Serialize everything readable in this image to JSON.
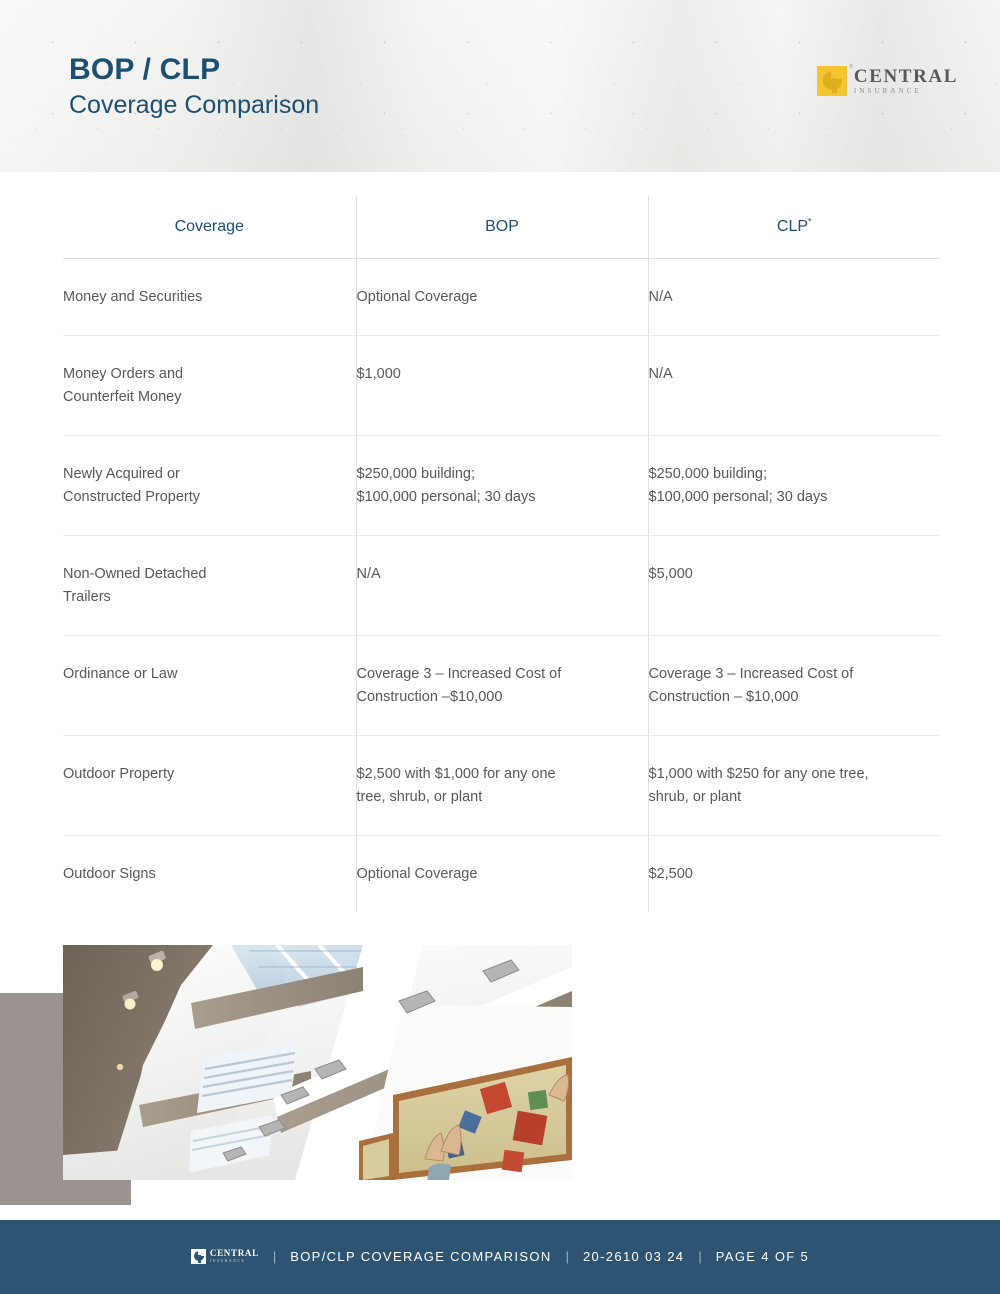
{
  "header": {
    "title_main": "BOP / CLP",
    "title_sub": "Coverage Comparison",
    "logo": {
      "name": "CENTRAL",
      "tagline": "INSURANCE",
      "registered_mark": "®"
    }
  },
  "table": {
    "columns": [
      {
        "label": "Coverage",
        "superscript": ""
      },
      {
        "label": "BOP",
        "superscript": ""
      },
      {
        "label": "CLP",
        "superscript": "*"
      }
    ],
    "rows": [
      {
        "coverage": "Money and Securities",
        "bop": "Optional Coverage",
        "clp": "N/A"
      },
      {
        "coverage": "Money Orders and\nCounterfeit Money",
        "bop": "$1,000",
        "clp": "N/A"
      },
      {
        "coverage": "Newly Acquired or\nConstructed Property",
        "bop": "$250,000 building;\n$100,000 personal; 30 days",
        "clp": "$250,000 building;\n$100,000 personal; 30 days"
      },
      {
        "coverage": "Non-Owned Detached\nTrailers",
        "bop": "N/A",
        "clp": "$5,000"
      },
      {
        "coverage": "Ordinance or Law",
        "bop": "Coverage 3 – Increased Cost of\nConstruction –$10,000",
        "clp": "Coverage 3 – Increased Cost of\nConstruction – $10,000"
      },
      {
        "coverage": "Outdoor Property",
        "bop": "$2,500 with $1,000 for any one\ntree, shrub, or plant",
        "clp": "$1,000 with $250 for any one tree,\nshrub, or plant"
      },
      {
        "coverage": "Outdoor Signs",
        "bop": "Optional Coverage",
        "clp": "$2,500"
      }
    ]
  },
  "photo": {
    "description": "Interior atrium ceiling with skylights and framed mural artwork"
  },
  "footer": {
    "logo_name": "CENTRAL",
    "logo_tagline": "INSURANCE",
    "separator": "|",
    "document_title": "BOP/CLP COVERAGE COMPARISON",
    "document_number": "20-2610 03 24",
    "page_label": "PAGE 4 OF 5"
  },
  "colors": {
    "brand_navy": "#1d4f73",
    "footer_bar": "#2d5473",
    "logo_yellow": "#f5c431",
    "grey_block": "#9a938f",
    "body_text": "#58585a",
    "rule": "#ececec"
  }
}
